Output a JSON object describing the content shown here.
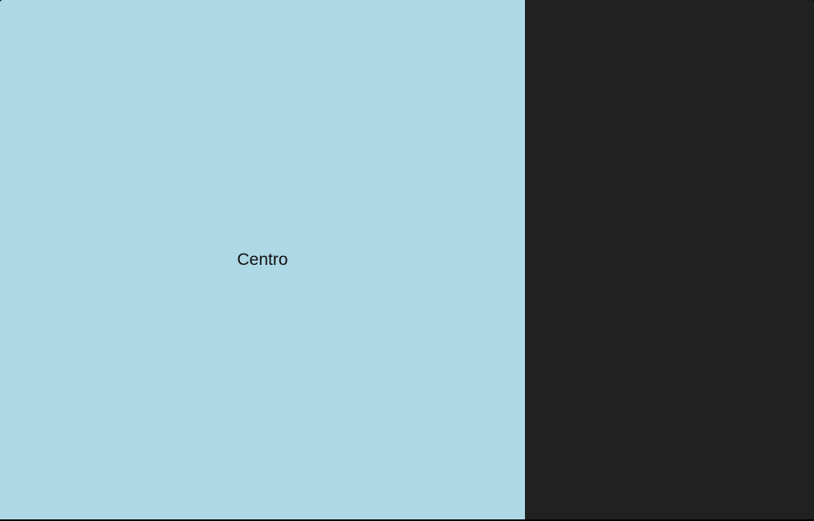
{
  "center_panel": {
    "label": "Centro",
    "background_color": "#add8e6"
  },
  "side_panel": {
    "background_color": "#212121"
  }
}
